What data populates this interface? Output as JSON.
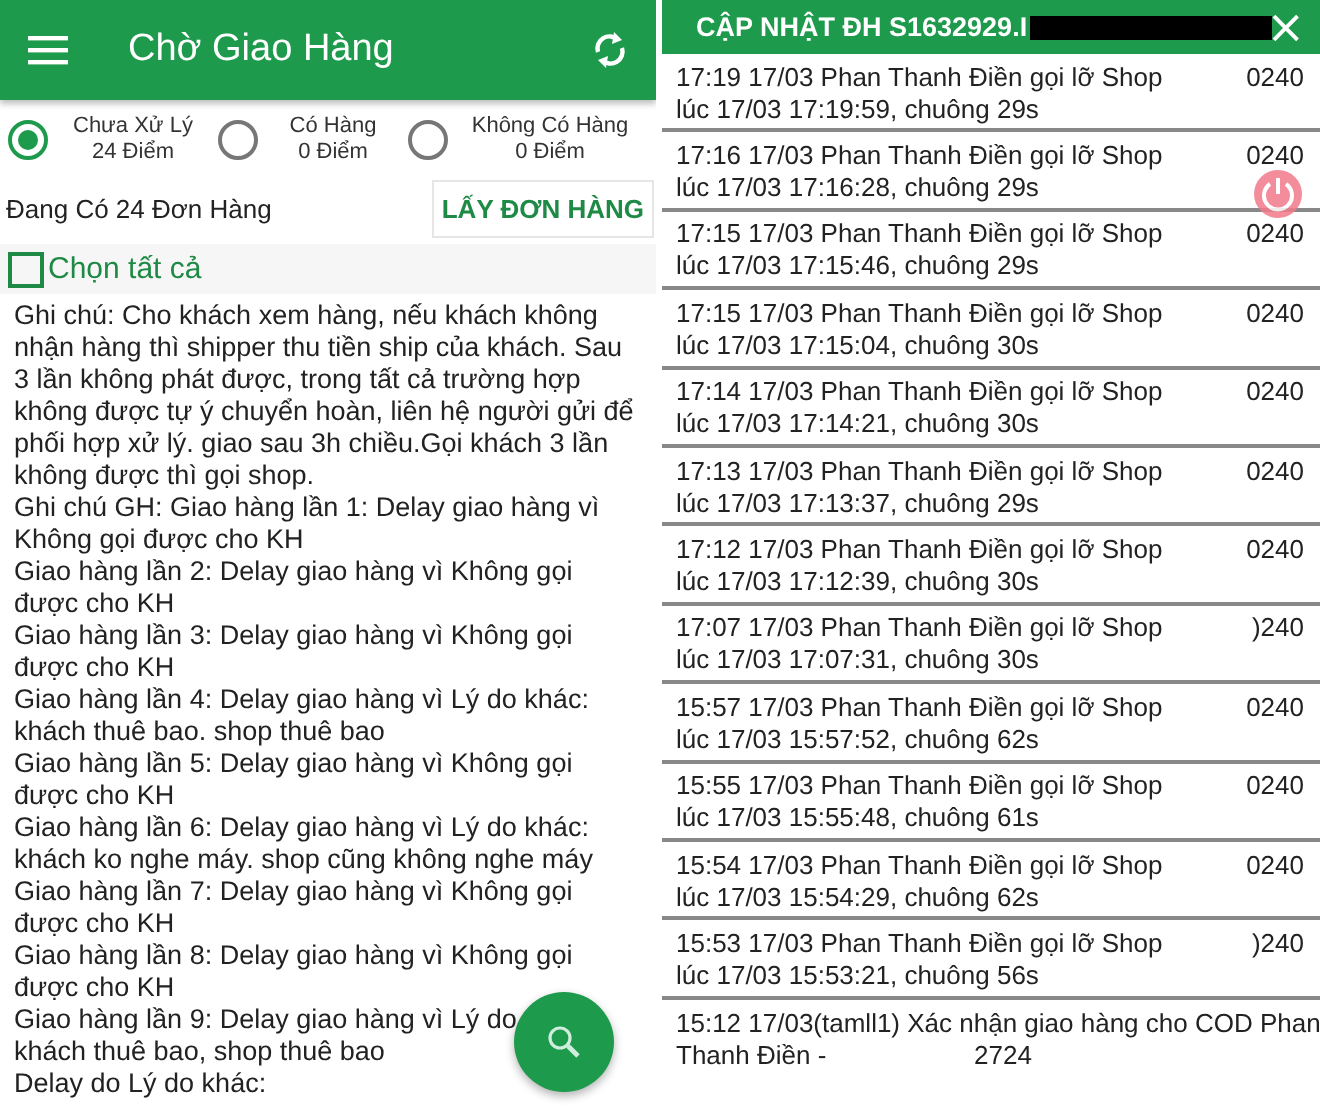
{
  "left": {
    "title": "Chờ Giao Hàng",
    "filters": [
      {
        "label": "Chưa Xử Lý",
        "count": "24 Điểm",
        "selected": true
      },
      {
        "label": "Có Hàng",
        "count": "0 Điểm",
        "selected": false
      },
      {
        "label": "Không Có Hàng",
        "count": "0 Điểm",
        "selected": false
      }
    ],
    "order_count": "Đang Có 24 Đơn Hàng",
    "fetch_button": "LẤY ĐƠN HÀNG",
    "select_all": {
      "label": "Chọn tất cả",
      "checked": false
    },
    "note_lines": [
      "Ghi chú: Cho khách xem hàng, nếu khách không",
      "nhận hàng thì shipper thu tiền ship của khách. Sau",
      "3 lần không phát được, trong tất cả trường hợp",
      "không được tự ý chuyển hoàn, liên hệ người gửi để",
      "phối hợp xử lý. giao sau 3h chiều.Gọi khách 3 lần",
      "không được thì gọi shop.",
      "Ghi chú GH: Giao hàng lần 1: Delay giao hàng vì",
      "Không gọi được cho KH",
      "Giao hàng lần 2: Delay giao hàng vì Không gọi",
      "được cho KH",
      "Giao hàng lần 3: Delay giao hàng vì Không gọi",
      "được cho KH",
      "Giao hàng lần 4: Delay giao hàng vì Lý do khác:",
      "khách thuê bao. shop thuê bao",
      "Giao hàng lần 5: Delay giao hàng vì Không gọi",
      "được cho KH",
      "Giao hàng lần 6: Delay giao hàng vì Lý do khác:",
      "khách ko nghe máy. shop cũng không nghe máy",
      "Giao hàng lần 7: Delay giao hàng vì Không gọi",
      "được cho KH",
      "Giao hàng lần 8: Delay giao hàng vì Không gọi",
      "được cho KH",
      "Giao hàng lần 9: Delay giao hàng vì Lý do",
      "khách thuê bao, shop thuê bao",
      "Delay do Lý do khác:"
    ]
  },
  "right": {
    "title": "CẬP NHẬT ĐH S1632929.I",
    "entries": [
      {
        "kind": "call",
        "line1": "17:19 17/03 Phan Thanh Điền gọi lỡ Shop",
        "line2": "lúc 17/03 17:19:59, chuông 29s",
        "number": "0240"
      },
      {
        "kind": "call",
        "line1": "17:16 17/03 Phan Thanh Điền gọi lỡ Shop",
        "line2": "lúc 17/03 17:16:28, chuông 29s",
        "number": "0240"
      },
      {
        "kind": "call",
        "line1": "17:15 17/03 Phan Thanh Điền gọi lỡ Shop",
        "line2": "lúc 17/03 17:15:46, chuông 29s",
        "number": "0240"
      },
      {
        "kind": "call",
        "line1": "17:15 17/03 Phan Thanh Điền gọi lỡ Shop",
        "line2": "lúc 17/03 17:15:04, chuông 30s",
        "number": "0240"
      },
      {
        "kind": "call",
        "line1": "17:14 17/03 Phan Thanh Điền gọi lỡ Shop",
        "line2": "lúc 17/03 17:14:21, chuông 30s",
        "number": "0240"
      },
      {
        "kind": "call",
        "line1": "17:13 17/03 Phan Thanh Điền gọi lỡ Shop",
        "line2": "lúc 17/03 17:13:37, chuông 29s",
        "number": "0240"
      },
      {
        "kind": "call",
        "line1": "17:12 17/03 Phan Thanh Điền gọi lỡ Shop",
        "line2": "lúc 17/03 17:12:39, chuông 30s",
        "number": "0240"
      },
      {
        "kind": "call",
        "line1": "17:07 17/03 Phan Thanh Điền gọi lỡ Shop",
        "line2": "lúc 17/03 17:07:31, chuông 30s",
        "number": ")240"
      },
      {
        "kind": "call",
        "line1": "15:57 17/03 Phan Thanh Điền gọi lỡ Shop",
        "line2": "lúc 17/03 15:57:52, chuông 62s",
        "number": "0240"
      },
      {
        "kind": "call",
        "line1": "15:55 17/03 Phan Thanh Điền gọi lỡ Shop",
        "line2": "lúc 17/03 15:55:48, chuông 61s",
        "number": "0240"
      },
      {
        "kind": "call",
        "line1": "15:54 17/03 Phan Thanh Điền gọi lỡ Shop",
        "line2": "lúc 17/03 15:54:29, chuông 62s",
        "number": "0240"
      },
      {
        "kind": "call",
        "line1": "15:53 17/03 Phan Thanh Điền gọi lỡ Shop",
        "line2": "lúc 17/03 15:53:21, chuông 56s",
        "number": ")240"
      },
      {
        "kind": "confirm",
        "line1": "15:12 17/03(tamll1) Xác nhận giao hàng cho COD Phan",
        "line2": "Thanh Điền -",
        "number": "2724"
      }
    ]
  }
}
